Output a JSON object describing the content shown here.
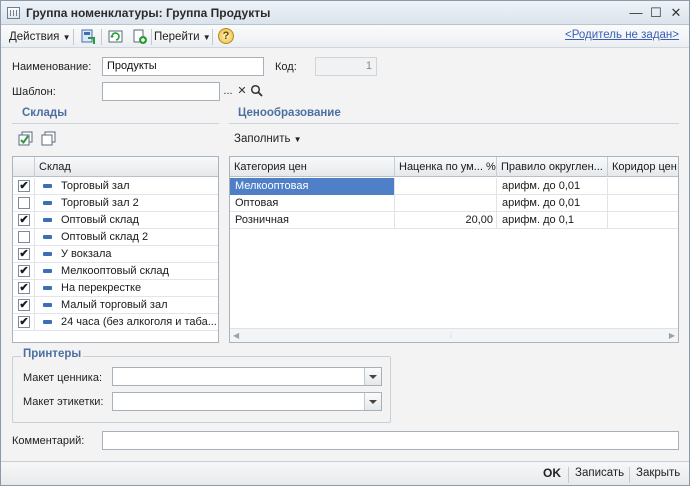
{
  "window": {
    "title": "Группа номенклатуры: Группа Продукты"
  },
  "toolbar": {
    "actions_label": "Действия",
    "goto_label": "Перейти",
    "help_icon_label": "?",
    "parent_link": "<Родитель не задан>"
  },
  "form": {
    "name_label": "Наименование:",
    "name_value": "Продукты",
    "code_label": "Код:",
    "code_value": "1",
    "template_label": "Шаблон:",
    "template_value": "",
    "ellipsis_label": "...",
    "clear_label": "✕"
  },
  "warehouses": {
    "section_title": "Склады",
    "column_header": "Склад",
    "rows": [
      {
        "name": "Торговый зал",
        "checked": "✔"
      },
      {
        "name": "Торговый зал 2",
        "checked": ""
      },
      {
        "name": "Оптовый склад",
        "checked": "✔"
      },
      {
        "name": "Оптовый склад 2",
        "checked": ""
      },
      {
        "name": "У вокзала",
        "checked": "✔"
      },
      {
        "name": "Мелкооптовый склад",
        "checked": "✔"
      },
      {
        "name": "На перекрестке",
        "checked": "✔"
      },
      {
        "name": "Малый торговый зал",
        "checked": "✔"
      },
      {
        "name": "24 часа (без алкоголя и таба...",
        "checked": "✔"
      }
    ]
  },
  "pricing": {
    "section_title": "Ценообразование",
    "fill_label": "Заполнить",
    "columns": [
      "Категория цен",
      "Наценка по ум... %",
      "Правило округлен...",
      "Коридор цен"
    ],
    "rows": [
      {
        "category": "Мелкооптовая",
        "markup": "",
        "rounding": "арифм. до 0,01",
        "corridor": ""
      },
      {
        "category": "Оптовая",
        "markup": "",
        "rounding": "арифм. до 0,01",
        "corridor": ""
      },
      {
        "category": "Розничная",
        "markup": "20,00",
        "rounding": "арифм. до 0,1",
        "corridor": ""
      }
    ]
  },
  "printers": {
    "section_title": "Принтеры",
    "price_tag_label": "Макет ценника:",
    "price_tag_value": "",
    "label_layout_label": "Макет этикетки:",
    "label_layout_value": ""
  },
  "comment": {
    "label": "Комментарий:",
    "value": ""
  },
  "footer": {
    "ok_label": "OK",
    "save_label": "Записать",
    "close_label": "Закрыть"
  }
}
